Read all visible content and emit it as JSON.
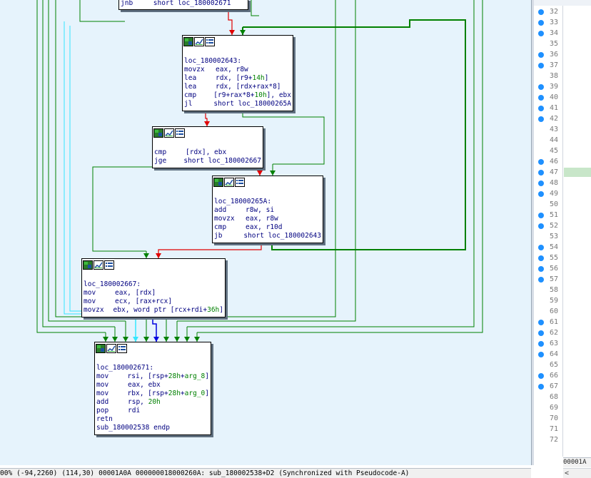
{
  "graph": {
    "top_partial_text": "jnb     short loc_180002671",
    "nodes": [
      {
        "id": "n2643",
        "label": "loc_180002643:",
        "instructions": [
          {
            "m": "movzx",
            "o": [
              {
                "t": "eax, r8w"
              }
            ]
          },
          {
            "m": "lea",
            "o": [
              {
                "t": "rdx, [r9+"
              },
              {
                "t": "14h",
                "c": "num"
              },
              {
                "t": "]"
              }
            ]
          },
          {
            "m": "lea",
            "o": [
              {
                "t": "rdx, [rdx+rax*8]"
              }
            ]
          },
          {
            "m": "cmp",
            "o": [
              {
                "t": "[r9+rax*8+"
              },
              {
                "t": "10h",
                "c": "num"
              },
              {
                "t": "], ebx"
              }
            ]
          },
          {
            "m": "jl",
            "o": [
              {
                "t": "short loc_18000265A"
              }
            ]
          }
        ]
      },
      {
        "id": "ncmp",
        "label": "",
        "instructions": [
          {
            "m": "cmp",
            "o": [
              {
                "t": "[rdx], ebx"
              }
            ]
          },
          {
            "m": "jge",
            "o": [
              {
                "t": "short loc_180002667"
              }
            ]
          }
        ]
      },
      {
        "id": "n265a",
        "label": "loc_18000265A:",
        "instructions": [
          {
            "m": "add",
            "o": [
              {
                "t": "r8w, si"
              }
            ]
          },
          {
            "m": "movzx",
            "o": [
              {
                "t": "eax, r8w"
              }
            ]
          },
          {
            "m": "cmp",
            "o": [
              {
                "t": "eax, r10d"
              }
            ]
          },
          {
            "m": "jb",
            "o": [
              {
                "t": "short loc_180002643"
              }
            ]
          }
        ]
      },
      {
        "id": "n2667",
        "label": "loc_180002667:",
        "instructions": [
          {
            "m": "mov",
            "o": [
              {
                "t": "eax, [rdx]"
              }
            ]
          },
          {
            "m": "mov",
            "o": [
              {
                "t": "ecx, [rax+rcx]"
              }
            ]
          },
          {
            "m": "movzx",
            "o": [
              {
                "t": "ebx, word ptr [rcx+rdi+"
              },
              {
                "t": "36h",
                "c": "num"
              },
              {
                "t": "]"
              }
            ]
          }
        ]
      },
      {
        "id": "n2671",
        "label": "loc_180002671:",
        "instructions": [
          {
            "m": "mov",
            "o": [
              {
                "t": "rsi, [rsp+"
              },
              {
                "t": "28h",
                "c": "num"
              },
              {
                "t": "+"
              },
              {
                "t": "arg_8",
                "c": "arg"
              },
              {
                "t": "]"
              }
            ]
          },
          {
            "m": "mov",
            "o": [
              {
                "t": "eax, ebx"
              }
            ]
          },
          {
            "m": "mov",
            "o": [
              {
                "t": "rbx, [rsp+"
              },
              {
                "t": "28h",
                "c": "num"
              },
              {
                "t": "+"
              },
              {
                "t": "arg_0",
                "c": "arg"
              },
              {
                "t": "]"
              }
            ]
          },
          {
            "m": "add",
            "o": [
              {
                "t": "rsp, "
              },
              {
                "t": "20h",
                "c": "num"
              }
            ]
          },
          {
            "m": "pop",
            "o": [
              {
                "t": "rdi"
              }
            ]
          },
          {
            "m": "retn",
            "o": []
          }
        ],
        "footer": "sub_180002538 endp"
      }
    ],
    "colors": {
      "green": "#008000",
      "red": "#e00000",
      "blue": "#0000e0",
      "cyan": "#33e6ff",
      "graph_bg": "#e6f3fc"
    }
  },
  "gutter": {
    "lines": [
      {
        "n": "32",
        "dot": true
      },
      {
        "n": "33",
        "dot": true
      },
      {
        "n": "34",
        "dot": true
      },
      {
        "n": "35",
        "dot": false
      },
      {
        "n": "36",
        "dot": true
      },
      {
        "n": "37",
        "dot": true
      },
      {
        "n": "38",
        "dot": false
      },
      {
        "n": "39",
        "dot": true
      },
      {
        "n": "40",
        "dot": true
      },
      {
        "n": "41",
        "dot": true
      },
      {
        "n": "42",
        "dot": true
      },
      {
        "n": "43",
        "dot": false
      },
      {
        "n": "44",
        "dot": false
      },
      {
        "n": "45",
        "dot": false
      },
      {
        "n": "46",
        "dot": true
      },
      {
        "n": "47",
        "dot": true
      },
      {
        "n": "48",
        "dot": true
      },
      {
        "n": "49",
        "dot": true
      },
      {
        "n": "50",
        "dot": false
      },
      {
        "n": "51",
        "dot": true
      },
      {
        "n": "52",
        "dot": true
      },
      {
        "n": "53",
        "dot": false
      },
      {
        "n": "54",
        "dot": true
      },
      {
        "n": "55",
        "dot": true
      },
      {
        "n": "56",
        "dot": true
      },
      {
        "n": "57",
        "dot": true
      },
      {
        "n": "58",
        "dot": false
      },
      {
        "n": "59",
        "dot": false
      },
      {
        "n": "60",
        "dot": false
      },
      {
        "n": "61",
        "dot": true
      },
      {
        "n": "62",
        "dot": true
      },
      {
        "n": "63",
        "dot": true
      },
      {
        "n": "64",
        "dot": true
      },
      {
        "n": "65",
        "dot": false
      },
      {
        "n": "66",
        "dot": true
      },
      {
        "n": "67",
        "dot": true
      },
      {
        "n": "68",
        "dot": false
      },
      {
        "n": "69",
        "dot": false
      },
      {
        "n": "70",
        "dot": false
      },
      {
        "n": "71",
        "dot": false
      },
      {
        "n": "72",
        "dot": false
      }
    ]
  },
  "status": {
    "zoom": "00%",
    "coord1": "(-94,2260)",
    "coord2": "(114,30)",
    "offset": "00001A0A",
    "address": "000000018000260A: sub_180002538+D2",
    "sync": "(Synchronized with Pseudocode-A)"
  },
  "pseudocode_status": "00001A",
  "hscroll_left": "<"
}
